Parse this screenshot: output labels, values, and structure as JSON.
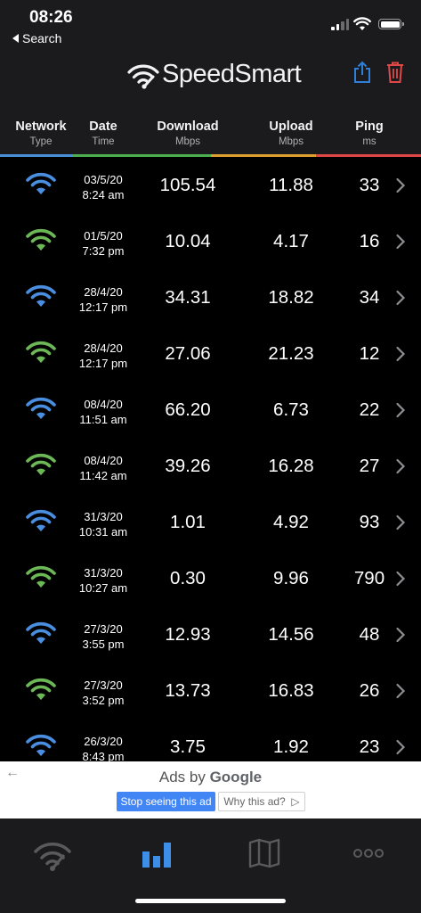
{
  "status_bar": {
    "time": "08:26",
    "back_label": "Search"
  },
  "app": {
    "name": "SpeedSmart"
  },
  "columns": {
    "network": {
      "title": "Network",
      "subtitle": "Type"
    },
    "date": {
      "title": "Date",
      "subtitle": "Time"
    },
    "download": {
      "title": "Download",
      "subtitle": "Mbps"
    },
    "upload": {
      "title": "Upload",
      "subtitle": "Mbps"
    },
    "ping": {
      "title": "Ping",
      "subtitle": "ms"
    }
  },
  "accent_colors": {
    "network": "#4a90d9",
    "date": "#4caf50",
    "download": "#4caf50",
    "upload": "#e0a030",
    "ping": "#e04848",
    "wifi_blue": "#4a8ee0",
    "wifi_green": "#6db856"
  },
  "results": [
    {
      "wifi": "blue",
      "date": "03/5/20",
      "time": "8:24 am",
      "download": "105.54",
      "upload": "11.88",
      "ping": "33"
    },
    {
      "wifi": "green",
      "date": "01/5/20",
      "time": "7:32 pm",
      "download": "10.04",
      "upload": "4.17",
      "ping": "16"
    },
    {
      "wifi": "blue",
      "date": "28/4/20",
      "time": "12:17 pm",
      "download": "34.31",
      "upload": "18.82",
      "ping": "34"
    },
    {
      "wifi": "green",
      "date": "28/4/20",
      "time": "12:17 pm",
      "download": "27.06",
      "upload": "21.23",
      "ping": "12"
    },
    {
      "wifi": "blue",
      "date": "08/4/20",
      "time": "11:51 am",
      "download": "66.20",
      "upload": "6.73",
      "ping": "22"
    },
    {
      "wifi": "green",
      "date": "08/4/20",
      "time": "11:42 am",
      "download": "39.26",
      "upload": "16.28",
      "ping": "27"
    },
    {
      "wifi": "blue",
      "date": "31/3/20",
      "time": "10:31 am",
      "download": "1.01",
      "upload": "4.92",
      "ping": "93"
    },
    {
      "wifi": "green",
      "date": "31/3/20",
      "time": "10:27 am",
      "download": "0.30",
      "upload": "9.96",
      "ping": "790"
    },
    {
      "wifi": "blue",
      "date": "27/3/20",
      "time": "3:55 pm",
      "download": "12.93",
      "upload": "14.56",
      "ping": "48"
    },
    {
      "wifi": "green",
      "date": "27/3/20",
      "time": "3:52 pm",
      "download": "13.73",
      "upload": "16.83",
      "ping": "26"
    },
    {
      "wifi": "blue",
      "date": "26/3/20",
      "time": "8:43 pm",
      "download": "3.75",
      "upload": "1.92",
      "ping": "23"
    }
  ],
  "ad": {
    "ads_by": "Ads by",
    "brand": "Google",
    "stop_label": "Stop seeing this ad",
    "why_label": "Why this ad?"
  },
  "tabs": [
    {
      "name": "speed-test",
      "icon": "wifi-gauge-icon",
      "active": false
    },
    {
      "name": "results",
      "icon": "bar-chart-icon",
      "active": true
    },
    {
      "name": "map",
      "icon": "map-icon",
      "active": false
    },
    {
      "name": "more",
      "icon": "more-dots-icon",
      "active": false
    }
  ]
}
